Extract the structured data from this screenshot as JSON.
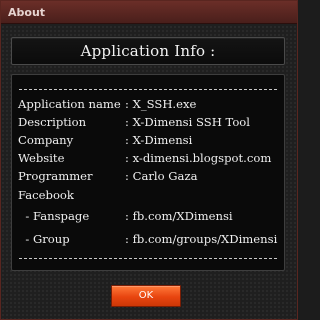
{
  "window": {
    "title": "About"
  },
  "header": {
    "title": "Application Info :"
  },
  "info": {
    "rows": [
      {
        "label": "Application name",
        "value": ": X_SSH.exe"
      },
      {
        "label": "Description",
        "value": ": X-Dimensi SSH Tool"
      },
      {
        "label": "Company",
        "value": ": X-Dimensi"
      },
      {
        "label": "Website",
        "value": ": x-dimensi.blogspot.com"
      },
      {
        "label": "Programmer",
        "value": ": Carlo Gaza"
      },
      {
        "label": "Facebook",
        "value": ""
      },
      {
        "label": "  - Fanspage",
        "value": ": fb.com/XDimensi"
      },
      {
        "label": "  - Group",
        "value": ": fb.com/groups/XDimensi"
      }
    ]
  },
  "buttons": {
    "ok_label": "OK"
  },
  "colors": {
    "title_bar": "#5c2722",
    "ok_button": "#f05a1a",
    "panel_bg": "#0a0a0a"
  }
}
